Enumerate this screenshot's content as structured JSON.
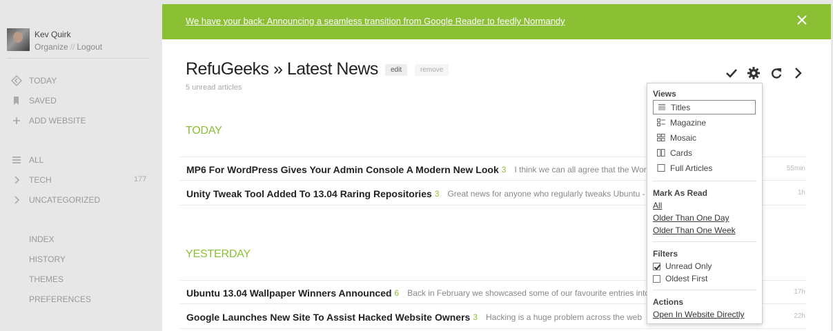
{
  "user": {
    "name": "Kev Quirk",
    "organize": "Organize",
    "separator": "//",
    "logout": "Logout"
  },
  "sidebar": {
    "primary": [
      {
        "label": "TODAY",
        "icon": "today-icon"
      },
      {
        "label": "SAVED",
        "icon": "bookmark-icon"
      },
      {
        "label": "ADD WEBSITE",
        "icon": "plus-icon"
      }
    ],
    "categories": [
      {
        "label": "ALL",
        "icon": "list-icon",
        "count": ""
      },
      {
        "label": "TECH",
        "icon": "chevron-right-icon",
        "count": "177"
      },
      {
        "label": "UNCATEGORIZED",
        "icon": "chevron-right-icon",
        "count": ""
      }
    ],
    "secondary": [
      "INDEX",
      "HISTORY",
      "THEMES",
      "PREFERENCES"
    ]
  },
  "banner": {
    "text": "We have your back: Announcing a seamless transition from Google Reader to feedly Normandy",
    "color": "#8bc034"
  },
  "header": {
    "title": "RefuGeeks » Latest News",
    "edit": "edit",
    "remove": "remove",
    "unread": "5 unread articles"
  },
  "toolbar": [
    "checkmark-icon",
    "gear-icon",
    "refresh-icon",
    "chevron-right-icon"
  ],
  "sections": [
    {
      "heading": "TODAY",
      "articles": [
        {
          "title": "MP6 For WordPress Gives Your Admin Console A Modern New Look",
          "count": "3",
          "snippet": "I think we can all agree that the WordPress admin console looks a",
          "time": "55min"
        },
        {
          "title": "Unity Tweak Tool Added To 13.04 Raring Repositories",
          "count": "3",
          "snippet": "Great news for anyone who regularly tweaks Ubuntu - which is most of us.",
          "time": "1h"
        }
      ]
    },
    {
      "heading": "YESTERDAY",
      "articles": [
        {
          "title": "Ubuntu 13.04 Wallpaper Winners Announced",
          "count": "6",
          "snippet": "Back in February we showcased some of our favourite entries into the wallpaper",
          "time": "17h"
        },
        {
          "title": "Google Launches New Site To Assist Hacked Website Owners",
          "count": "3",
          "snippet": "Hacking is a huge problem across the web",
          "time": "22h"
        }
      ]
    }
  ],
  "dropdown": {
    "views_head": "Views",
    "views": [
      "Titles",
      "Magazine",
      "Mosaic",
      "Cards",
      "Full Articles"
    ],
    "selected_view": "Titles",
    "mark_head": "Mark As Read",
    "mark": [
      "All",
      "Older Than One Day",
      "Older Than One Week"
    ],
    "filters_head": "Filters",
    "filters": [
      {
        "label": "Unread Only",
        "checked": true
      },
      {
        "label": "Oldest First",
        "checked": false
      }
    ],
    "actions_head": "Actions",
    "actions": [
      "Open In Website Directly"
    ]
  }
}
